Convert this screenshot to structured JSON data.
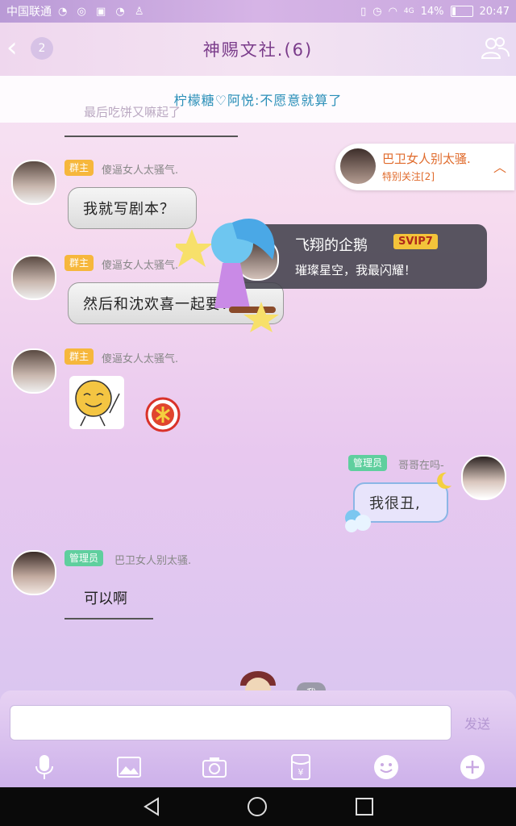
{
  "status_bar": {
    "carrier": "中国联通",
    "battery": "14%",
    "time": "20:47",
    "network": "4G"
  },
  "header": {
    "unread_count": "2",
    "title": "神赐文社.(6)"
  },
  "notice": {
    "text": "柠檬糖♡阿悦:不愿意就算了"
  },
  "faded_message": "最后吃饼又嘛起了",
  "special_follow": {
    "name": "巴卫女人别太骚.",
    "subtitle": "特别关注[2]"
  },
  "vip_banner": {
    "name": "飞翔的企鹅",
    "badge": "SVIP7",
    "subtitle": "璀璨星空，我最闪耀！"
  },
  "messages": [
    {
      "tag": "群主",
      "nick": "傻逼女人太骚气.",
      "text": "我就写剧本？"
    },
    {
      "tag": "群主",
      "nick": "傻逼女人太骚气.",
      "text": "然后和沈欢喜一起要？"
    },
    {
      "tag": "群主",
      "nick": "傻逼女人太骚气."
    },
    {
      "tag": "管理员",
      "nick": "哥哥在吗-",
      "text": "我很丑,"
    },
    {
      "tag": "管理员",
      "nick": "巴卫女人别太骚.",
      "text": "可以啊"
    }
  ],
  "input": {
    "placeholder": "",
    "send_label": "发送",
    "me_label": "我"
  },
  "colors": {
    "title": "#7a3b8a",
    "notice_text": "#2a8fb8",
    "owner_tag": "#f6b73c",
    "admin_tag": "#5fcf9e"
  },
  "icons": [
    "back-icon",
    "group-members-icon",
    "mic-icon",
    "image-icon",
    "camera-icon",
    "red-packet-icon",
    "emoji-icon",
    "plus-icon",
    "nav-back-icon",
    "nav-home-icon",
    "nav-recent-icon"
  ]
}
